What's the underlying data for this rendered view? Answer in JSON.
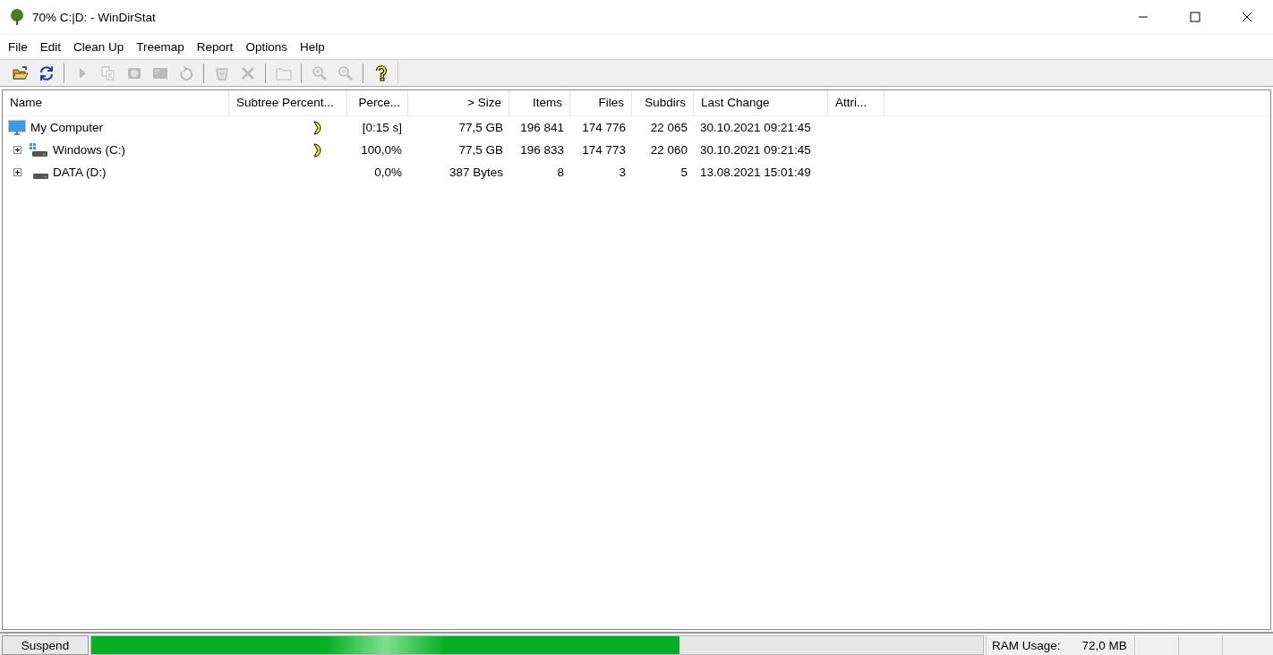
{
  "window": {
    "title": "70% C:|D: - WinDirStat"
  },
  "menu": [
    "File",
    "Edit",
    "Clean Up",
    "Treemap",
    "Report",
    "Options",
    "Help"
  ],
  "toolbar": [
    {
      "kind": "open",
      "disabled": false
    },
    {
      "kind": "refresh",
      "disabled": false
    },
    {
      "kind": "separator"
    },
    {
      "kind": "play",
      "disabled": true
    },
    {
      "kind": "copy",
      "disabled": true
    },
    {
      "kind": "explorer",
      "disabled": true
    },
    {
      "kind": "prompt",
      "disabled": true
    },
    {
      "kind": "refresh-one",
      "disabled": true
    },
    {
      "kind": "separator"
    },
    {
      "kind": "recycle",
      "disabled": true
    },
    {
      "kind": "delete",
      "disabled": true
    },
    {
      "kind": "separator"
    },
    {
      "kind": "folder",
      "disabled": true
    },
    {
      "kind": "separator"
    },
    {
      "kind": "zoom-in",
      "disabled": true
    },
    {
      "kind": "zoom-out",
      "disabled": true
    },
    {
      "kind": "separator"
    },
    {
      "kind": "help",
      "disabled": false
    }
  ],
  "table": {
    "columns": [
      "Name",
      "Subtree Percent...",
      "Perce...",
      "> Size",
      "Items",
      "Files",
      "Subdirs",
      "Last Change",
      "Attri..."
    ],
    "rows": [
      {
        "kind": "computer",
        "name": "My Computer",
        "scanning": true,
        "percent": "[0:15 s]",
        "size": "77,5 GB",
        "items": "196 841",
        "files": "174 776",
        "subdirs": "22 065",
        "last_change": "30.10.2021  09:21:45",
        "children": [
          {
            "kind": "system-drive",
            "name": "Windows (C:)",
            "scanning": true,
            "percent": "100,0%",
            "size": "77,5 GB",
            "items": "196 833",
            "files": "174 773",
            "subdirs": "22 060",
            "last_change": "30.10.2021  09:21:45",
            "expanded": false
          },
          {
            "kind": "drive",
            "name": "DATA (D:)",
            "scanning": false,
            "percent": "0,0%",
            "size": "387 Bytes",
            "items": "8",
            "files": "3",
            "subdirs": "5",
            "last_change": "13.08.2021  15:01:49",
            "expanded": false
          }
        ]
      }
    ]
  },
  "status_bar": {
    "button": "Suspend",
    "progress": {
      "level": 0.66
    },
    "ram_label": "RAM Usage:",
    "ram_value": "72,0 MB"
  }
}
